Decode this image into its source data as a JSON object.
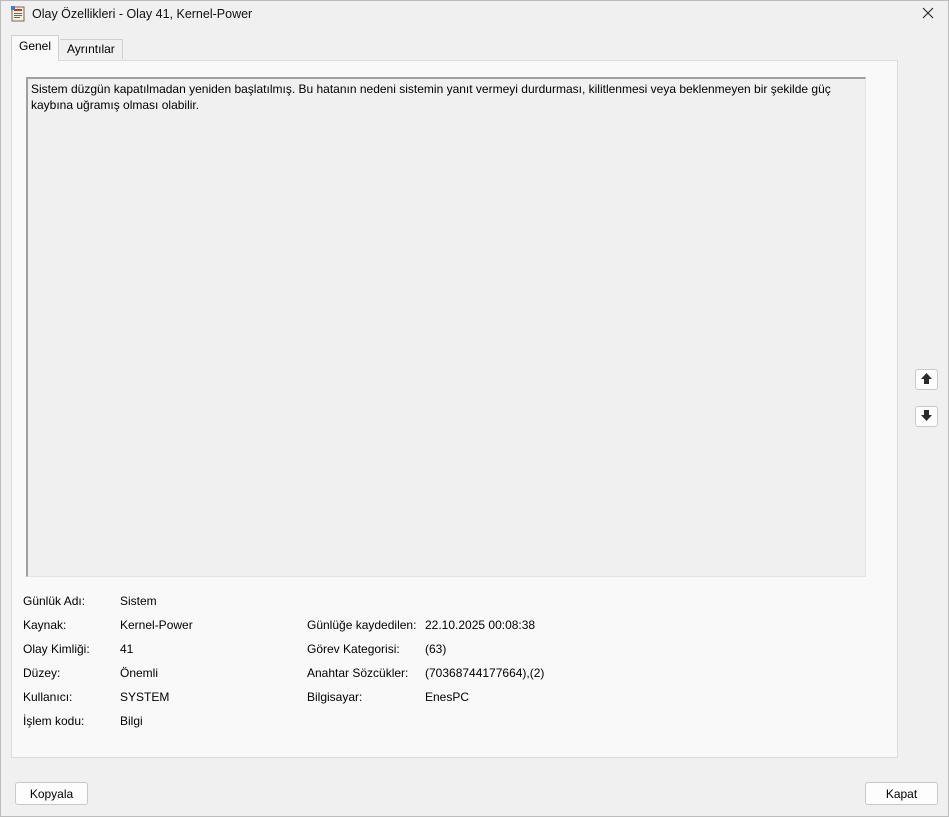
{
  "window": {
    "title": "Olay Özellikleri - Olay 41, Kernel-Power"
  },
  "tabs": [
    {
      "label": "Genel",
      "active": true
    },
    {
      "label": "Ayrıntılar",
      "active": false
    }
  ],
  "description": "Sistem düzgün kapatılmadan yeniden başlatılmış. Bu hatanın nedeni sistemin yanıt vermeyi durdurması, kilitlenmesi veya beklenmeyen bir şekilde güç kaybına uğramış olması olabilir.",
  "fields_left": [
    {
      "label": "Günlük Adı:",
      "value": "Sistem"
    },
    {
      "label": "Kaynak:",
      "value": "Kernel-Power"
    },
    {
      "label": "Olay Kimliği:",
      "value": "41"
    },
    {
      "label": "Düzey:",
      "value": "Önemli"
    },
    {
      "label": "Kullanıcı:",
      "value": "SYSTEM"
    },
    {
      "label": "İşlem kodu:",
      "value": "Bilgi"
    }
  ],
  "fields_right": [
    {
      "label": "Günlüğe kaydedilen:",
      "value": "22.10.2025 00:08:38"
    },
    {
      "label": "Görev Kategorisi:",
      "value": "(63)"
    },
    {
      "label": "Anahtar Sözcükler:",
      "value": "(70368744177664),(2)"
    },
    {
      "label": "Bilgisayar:",
      "value": "EnesPC"
    }
  ],
  "buttons": {
    "copy": "Kopyala",
    "close": "Kapat"
  },
  "icons": {
    "window": "event-properties-icon",
    "close": "close-icon",
    "up": "arrow-up-icon",
    "down": "arrow-down-icon"
  }
}
